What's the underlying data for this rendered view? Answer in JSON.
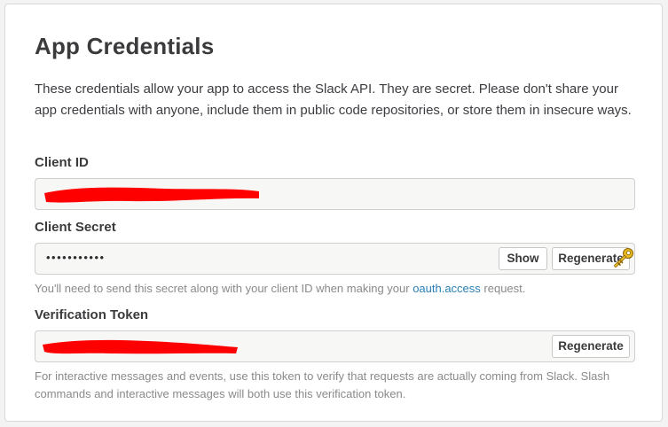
{
  "card": {
    "title": "App Credentials",
    "description": "These credentials allow your app to access the Slack API. They are secret. Please don't share your app credentials with anyone, include them in public code repositories, or store them in insecure ways."
  },
  "client_id": {
    "label": "Client ID",
    "value_redacted": true
  },
  "client_secret": {
    "label": "Client Secret",
    "masked_value": "•••••••••••",
    "show_label": "Show",
    "regenerate_label": "Regenerate",
    "hint_before": "You'll need to send this secret along with your client ID when making your ",
    "hint_link": "oauth.access",
    "hint_after": " request."
  },
  "verification_token": {
    "label": "Verification Token",
    "value_redacted": true,
    "regenerate_label": "Regenerate",
    "hint": "For interactive messages and events, use this token to verify that requests are actually coming from Slack. Slash commands and interactive messages will both use this verification token."
  },
  "colors": {
    "redaction": "#ff0000",
    "link": "#2a80b9",
    "hint_text": "#8a8a8d"
  },
  "icons": [
    "key-icon"
  ]
}
